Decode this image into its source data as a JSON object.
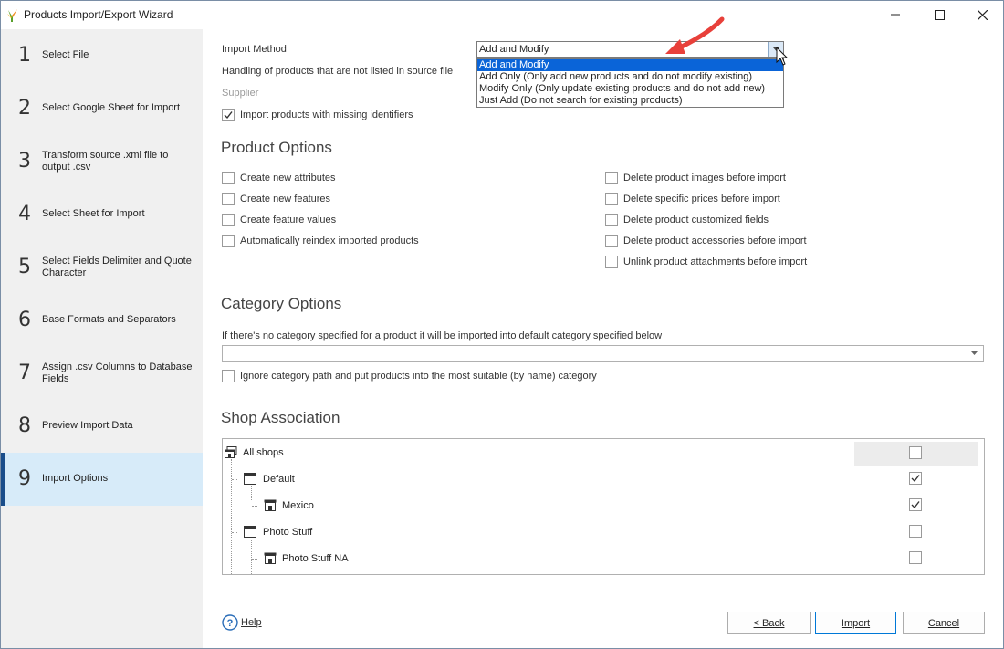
{
  "window": {
    "title": "Products Import/Export Wizard"
  },
  "sidebar": {
    "steps": [
      {
        "num": "1",
        "label": "Select File"
      },
      {
        "num": "2",
        "label": "Select Google Sheet for Import"
      },
      {
        "num": "3",
        "label": "Transform source .xml file to output .csv"
      },
      {
        "num": "4",
        "label": "Select Sheet for Import"
      },
      {
        "num": "5",
        "label": "Select Fields Delimiter and Quote Character"
      },
      {
        "num": "6",
        "label": "Base Formats and Separators"
      },
      {
        "num": "7",
        "label": "Assign .csv Columns to Database Fields"
      },
      {
        "num": "8",
        "label": "Preview Import Data"
      },
      {
        "num": "9",
        "label": "Import Options"
      }
    ],
    "active_step": 9
  },
  "import": {
    "method_label": "Import Method",
    "method_value": "Add and Modify",
    "method_options": [
      "Add and Modify",
      "Add Only (Only add new products and do not modify existing)",
      "Modify Only (Only update existing products and do not add new)",
      "Just Add (Do not search for existing products)"
    ],
    "handling_label": "Handling of products that are not listed in source file",
    "supplier_label": "Supplier",
    "missing_identifiers_label": "Import products with missing identifiers",
    "missing_identifiers_checked": true
  },
  "product_options": {
    "title": "Product Options",
    "left": [
      {
        "label": "Create new attributes",
        "checked": false
      },
      {
        "label": "Create new features",
        "checked": false
      },
      {
        "label": "Create feature values",
        "checked": false
      },
      {
        "label": "Automatically reindex imported products",
        "checked": false
      }
    ],
    "right": [
      {
        "label": "Delete product images before import",
        "checked": false
      },
      {
        "label": "Delete specific prices before import",
        "checked": false
      },
      {
        "label": "Delete product customized fields",
        "checked": false
      },
      {
        "label": "Delete product accessories before import",
        "checked": false
      },
      {
        "label": "Unlink product attachments before import",
        "checked": false
      }
    ]
  },
  "category_options": {
    "title": "Category Options",
    "description": "If there's no category specified for a product it will be imported into default category specified below",
    "default_category_value": "",
    "ignore_path_label": "Ignore category path and put products into the most suitable (by name) category",
    "ignore_path_checked": false
  },
  "shop_association": {
    "title": "Shop Association",
    "shops": [
      {
        "name": "All shops",
        "checked": false
      },
      {
        "name": "Default",
        "checked": true
      },
      {
        "name": "Mexico",
        "checked": true
      },
      {
        "name": "Photo Stuff",
        "checked": false
      },
      {
        "name": "Photo Stuff NA",
        "checked": false
      }
    ]
  },
  "footer": {
    "help_label": "Help",
    "back_label": "< Back",
    "import_label": "Import",
    "cancel_label": "Cancel"
  },
  "colors": {
    "active_step_bg": "#d7ebf9",
    "active_step_bar": "#1a4d8a",
    "dropdown_selected": "#0a64d8",
    "annotation_arrow": "#e8403a",
    "logo_green": "#5aa02c",
    "logo_orange": "#f08a1c"
  }
}
